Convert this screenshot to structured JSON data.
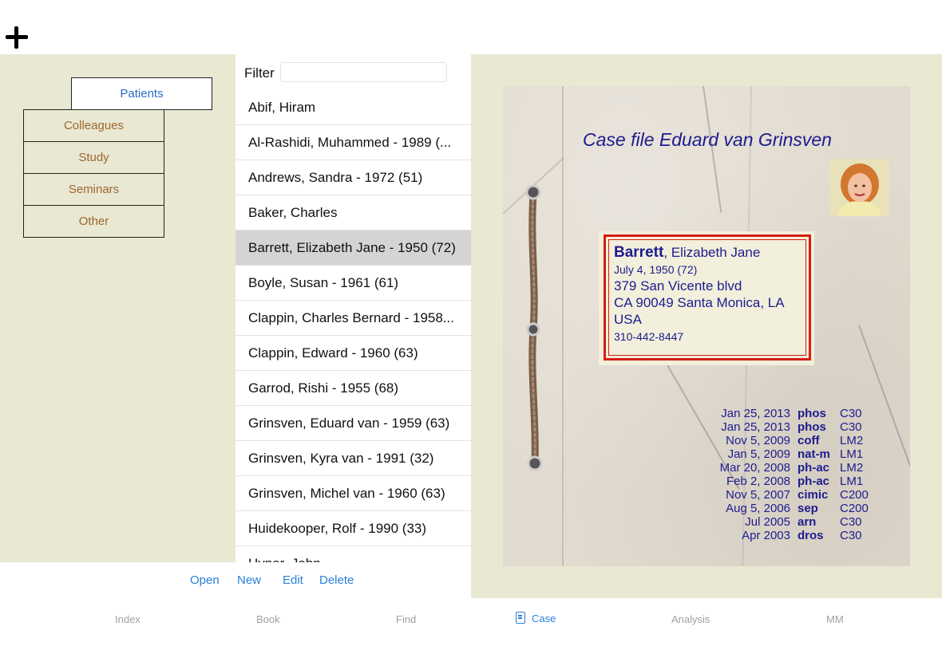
{
  "toolbar": {
    "add_icon": "plus-icon"
  },
  "nav": {
    "tabs": [
      {
        "label": "Patients",
        "active": true
      },
      {
        "label": "Colleagues",
        "active": false
      },
      {
        "label": "Study",
        "active": false
      },
      {
        "label": "Seminars",
        "active": false
      },
      {
        "label": "Other",
        "active": false
      }
    ]
  },
  "list": {
    "filter_label": "Filter",
    "filter_value": "",
    "filter_placeholder": "",
    "patients": [
      "Abif, Hiram",
      "Al-Rashidi, Muhammed - 1989 (...",
      "Andrews, Sandra - 1972 (51)",
      "Baker, Charles",
      "Barrett, Elizabeth Jane - 1950 (72)",
      "Boyle, Susan - 1961 (61)",
      "Clappin, Charles Bernard - 1958...",
      "Clappin, Edward - 1960 (63)",
      "Garrod, Rishi - 1955 (68)",
      "Grinsven, Eduard van - 1959 (63)",
      "Grinsven, Kyra van - 1991 (32)",
      "Grinsven, Michel van - 1960 (63)",
      "Huidekooper, Rolf - 1990 (33)",
      "Hyper, John"
    ],
    "selected_index": 4
  },
  "actions": {
    "open": "Open",
    "new": "New",
    "edit": "Edit",
    "delete": "Delete"
  },
  "case": {
    "title": "Case file Eduard van Grinsven",
    "photo_icon": "patient-photo",
    "label": {
      "surname": "Barrett",
      "given": ", Elizabeth Jane",
      "dob": "July 4, 1950 (72)",
      "street": "379 San Vicente blvd",
      "city": "CA 90049  Santa Monica, LA",
      "country": "USA",
      "phone": "310-442-8447"
    },
    "history": [
      {
        "date": "Jan 25, 2013",
        "remedy": "phos",
        "potency": "C30"
      },
      {
        "date": "Jan 25, 2013",
        "remedy": "phos",
        "potency": "C30"
      },
      {
        "date": "Nov 5, 2009",
        "remedy": "coff",
        "potency": "LM2"
      },
      {
        "date": "Jan 5, 2009",
        "remedy": "nat-m",
        "potency": "LM1"
      },
      {
        "date": "Mar 20, 2008",
        "remedy": "ph-ac",
        "potency": "LM2"
      },
      {
        "date": "Feb 2, 2008",
        "remedy": "ph-ac",
        "potency": "LM1"
      },
      {
        "date": "Nov 5, 2007",
        "remedy": "cimic",
        "potency": "C200"
      },
      {
        "date": "Aug 5, 2006",
        "remedy": "sep",
        "potency": "C200"
      },
      {
        "date": "Jul 2005",
        "remedy": "arn",
        "potency": "C30"
      },
      {
        "date": "Apr 2003",
        "remedy": "dros",
        "potency": "C30"
      }
    ]
  },
  "tabbar": {
    "tabs": [
      {
        "label": "Index",
        "active": false
      },
      {
        "label": "Book",
        "active": false
      },
      {
        "label": "Find",
        "active": false
      },
      {
        "label": "Case",
        "active": true,
        "icon": "case-icon"
      },
      {
        "label": "Analysis",
        "active": false
      },
      {
        "label": "MM",
        "active": false
      }
    ]
  },
  "colors": {
    "panel_bg": "#e8e8d3",
    "accent": "#2a80d8",
    "nav_text": "#a0662e",
    "case_text": "#1c1c8e",
    "label_border": "#d81d10",
    "selected_row": "#d4d4d6"
  }
}
